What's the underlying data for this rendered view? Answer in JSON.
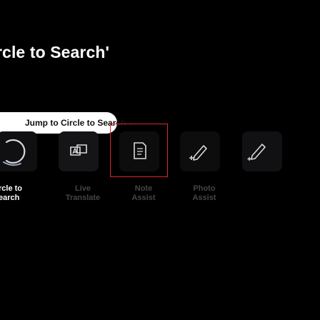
{
  "page": {
    "title": "rcle to Search'",
    "jump_button": {
      "label": "Jump to Circle to Search",
      "arrow": "↓"
    }
  },
  "features": [
    {
      "label_line1": "rcle to",
      "label_line2": "earch",
      "icon": "circle-to-search-icon",
      "active": true
    },
    {
      "label_line1": "Live",
      "label_line2": "Translate",
      "icon": "translate-icon",
      "active": false
    },
    {
      "label_line1": "Note",
      "label_line2": "Assist",
      "icon": "note-assist-icon",
      "active": false
    },
    {
      "label_line1": "Photo",
      "label_line2": "Assist",
      "icon": "photo-assist-icon",
      "active": false
    },
    {
      "label_line1": "",
      "label_line2": "",
      "icon": "photo-assist-icon",
      "active": false
    }
  ],
  "colors": {
    "selection": "#e0262c",
    "inactive_label": "#454545",
    "icon_stroke": "#d9d9d9"
  }
}
